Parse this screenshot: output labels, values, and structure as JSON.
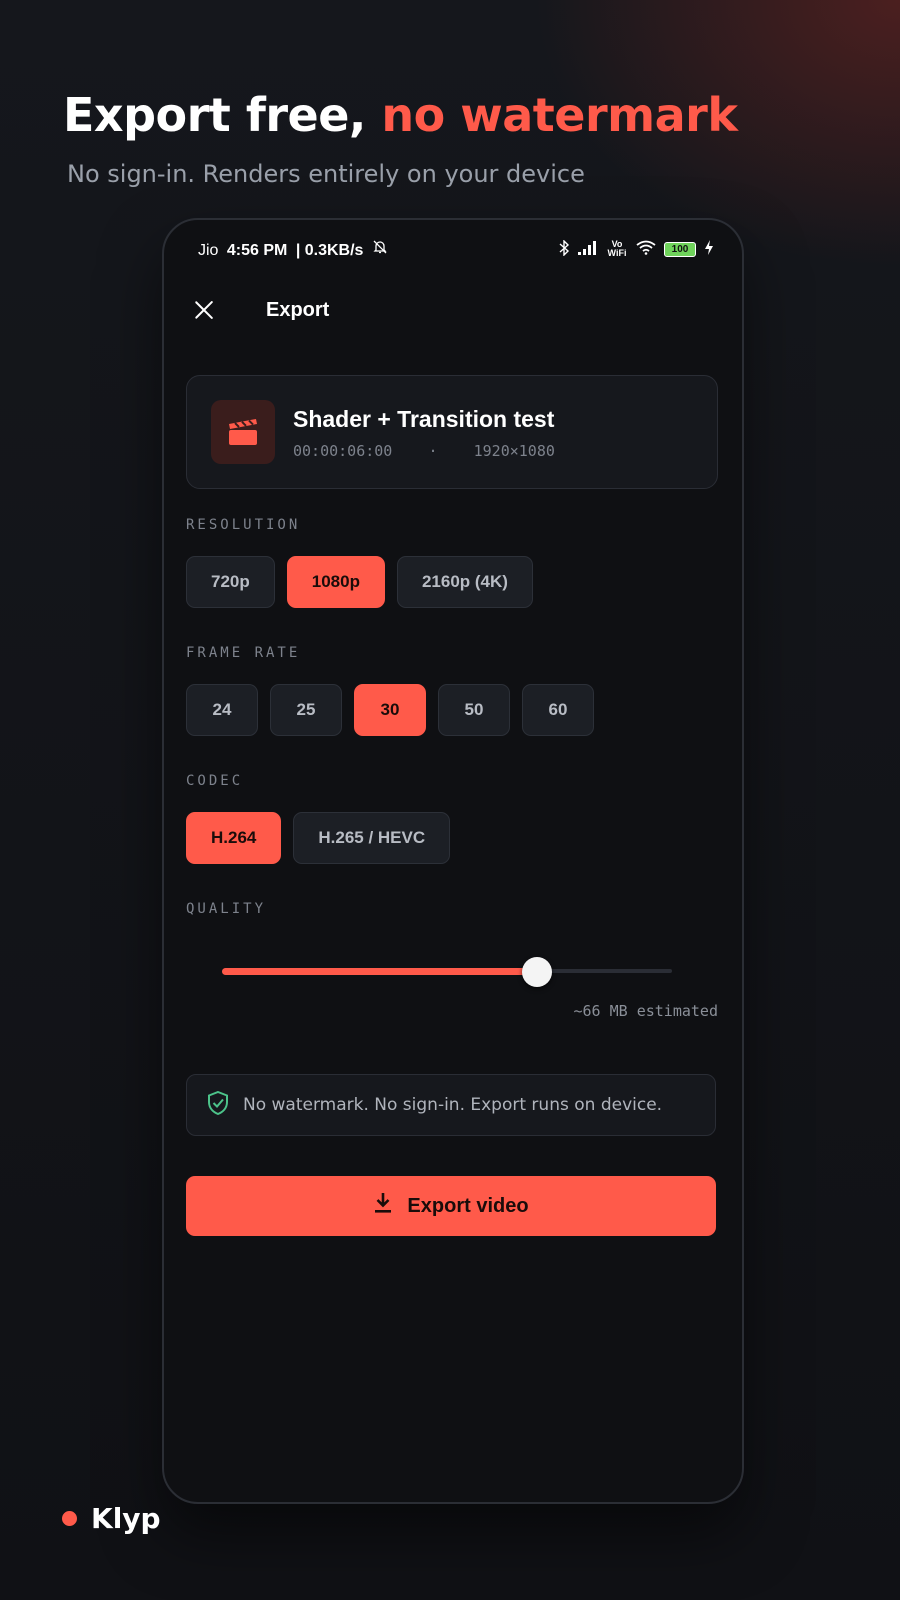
{
  "headline": {
    "prefix": "Export free, ",
    "accent": "no watermark"
  },
  "subheadline": "No sign-in. Renders entirely on your device",
  "status_bar": {
    "carrier": "Jio",
    "time": "4:56 PM",
    "speed": "| 0.3KB/s",
    "right_label": "Vo WiFi",
    "battery": "100"
  },
  "screen": {
    "title": "Export"
  },
  "project": {
    "name": "Shader + Transition test",
    "duration": "00:00:06:00",
    "separator": "·",
    "dimensions": "1920×1080"
  },
  "resolution": {
    "label": "RESOLUTION",
    "options": [
      "720p",
      "1080p",
      "2160p (4K)"
    ],
    "selected": "1080p"
  },
  "frame_rate": {
    "label": "FRAME RATE",
    "options": [
      "24",
      "25",
      "30",
      "50",
      "60"
    ],
    "selected": "30"
  },
  "codec": {
    "label": "CODEC",
    "options": [
      "H.264",
      "H.265 / HEVC"
    ],
    "selected": "H.264"
  },
  "quality": {
    "label": "QUALITY",
    "value_fraction": 0.7,
    "estimate": "~66 MB estimated"
  },
  "notice": "No watermark. No sign-in. Export runs on device.",
  "export_button": "Export video",
  "brand": "Klyp",
  "colors": {
    "accent": "#ff5a4a",
    "background": "#111216",
    "card": "#16181d",
    "shield": "#4cc38a"
  }
}
